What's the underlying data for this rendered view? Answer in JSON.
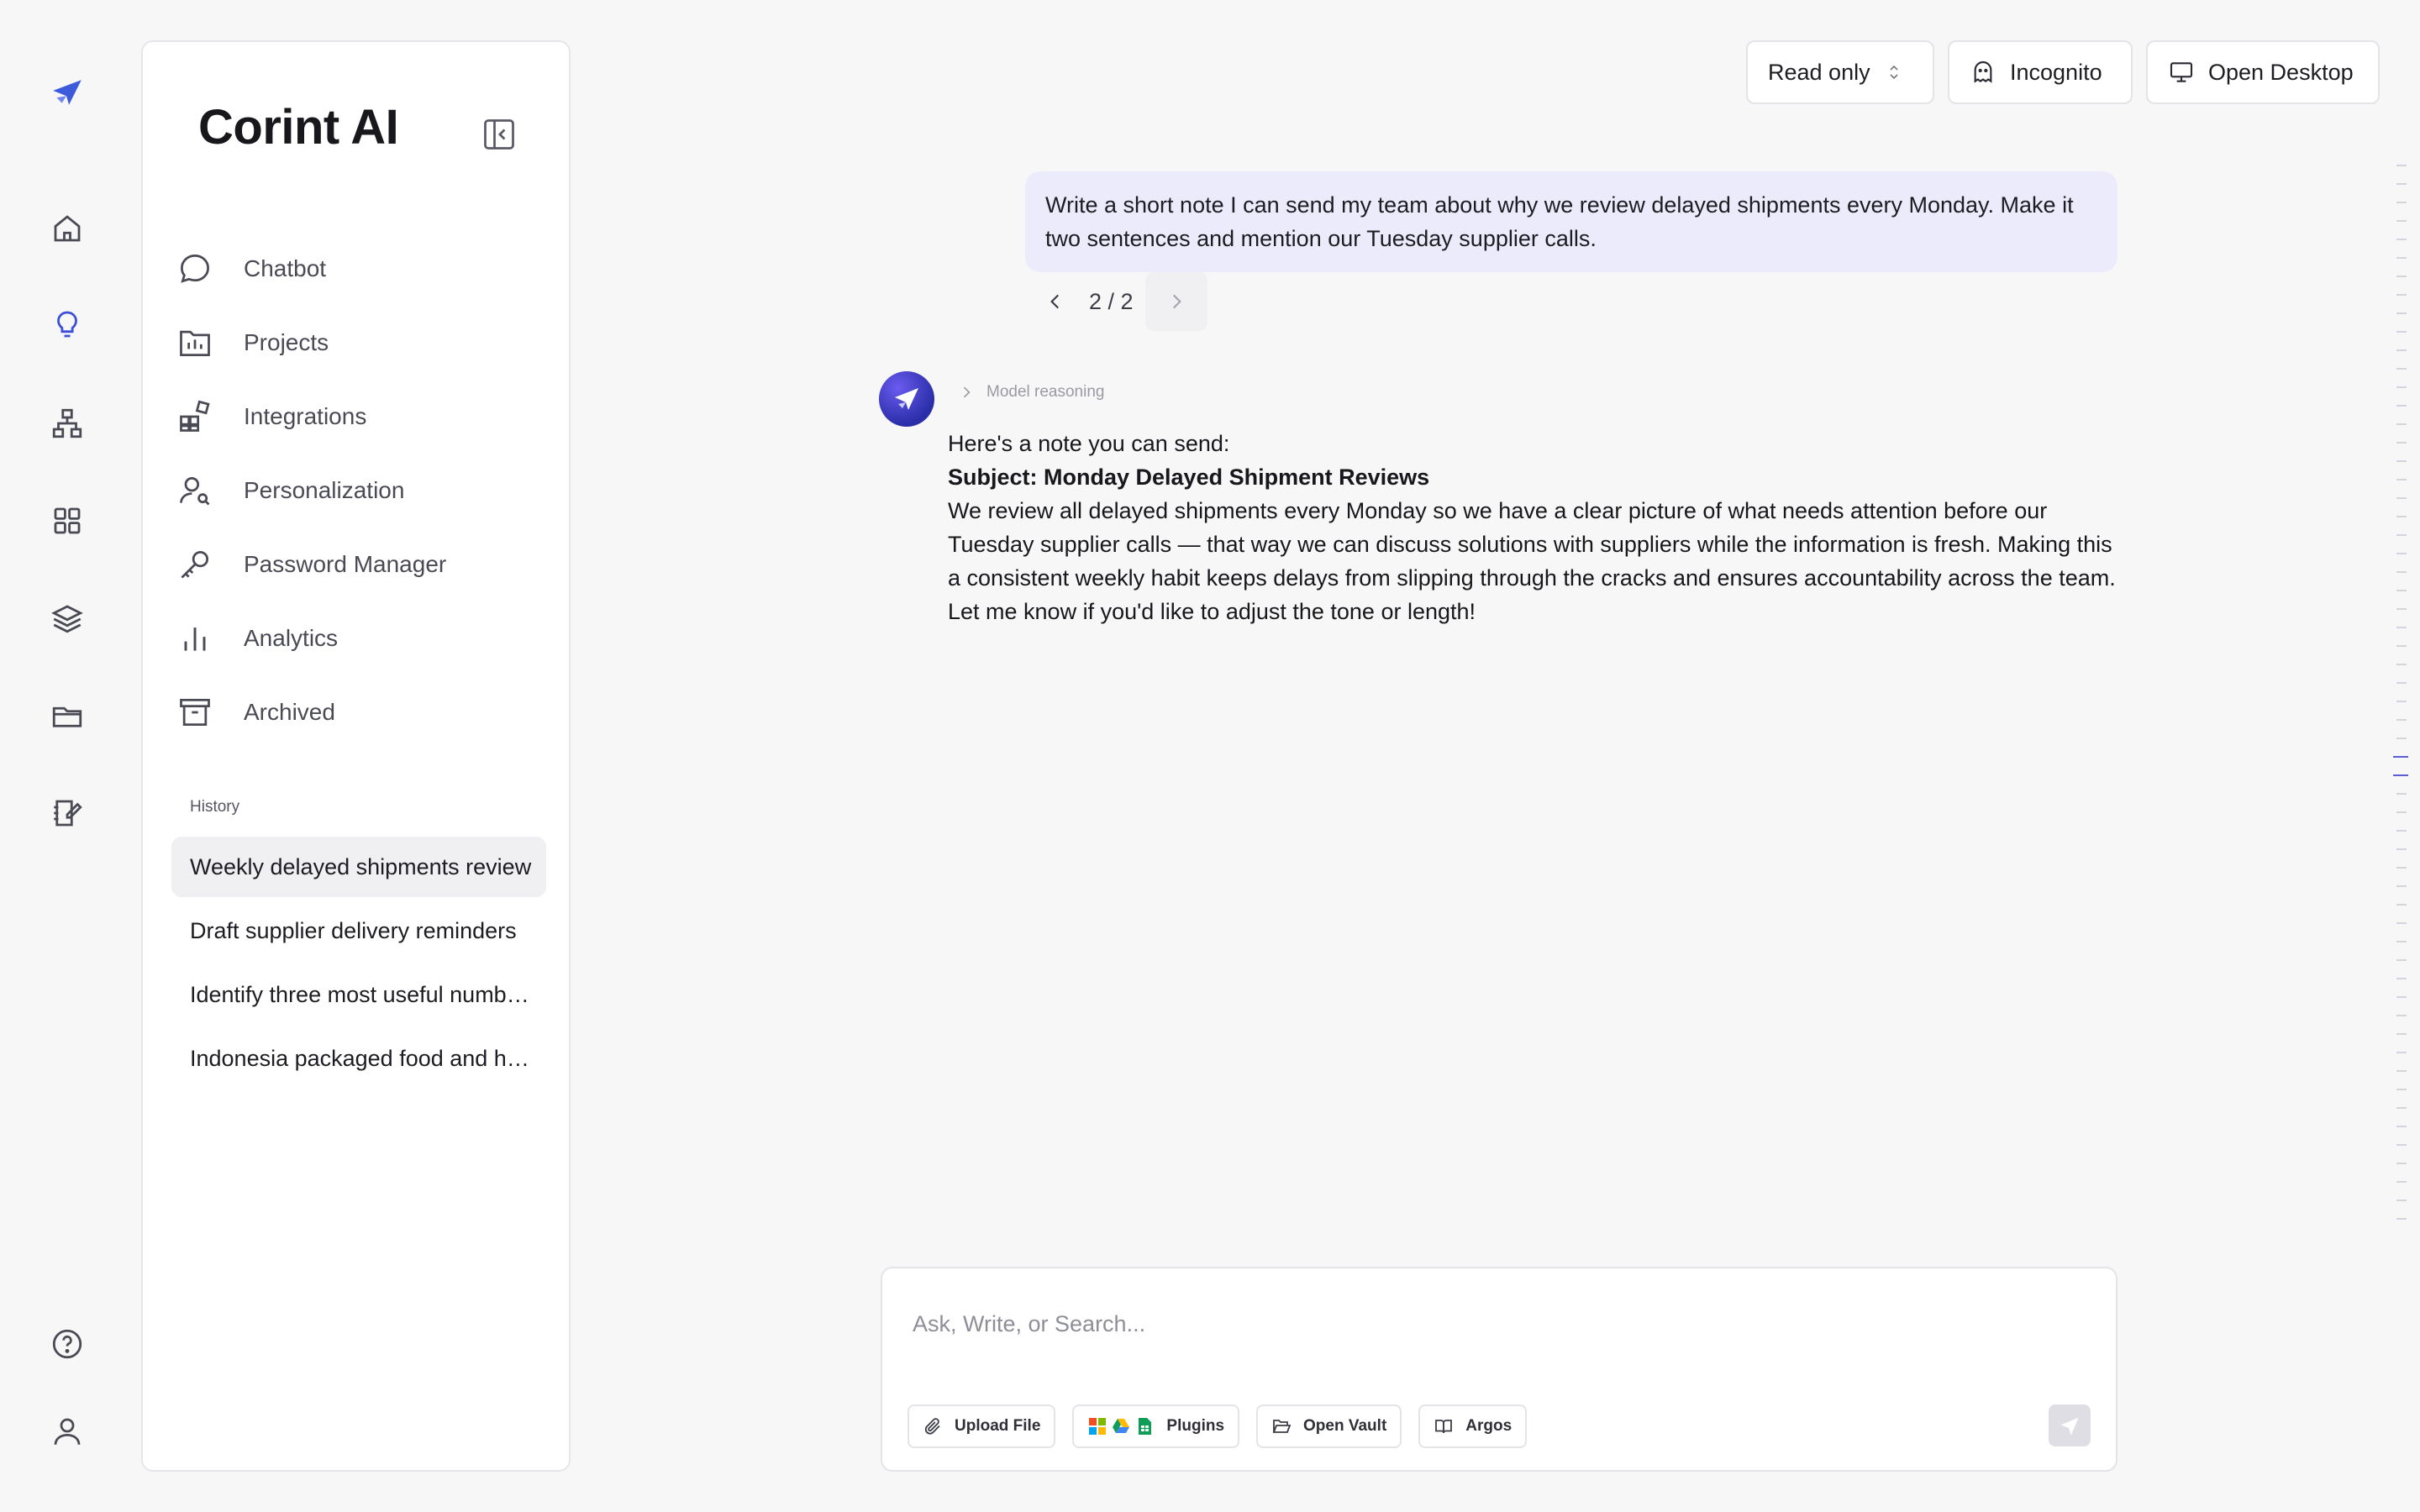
{
  "sidebar": {
    "brand": "Corint AI",
    "nav": [
      {
        "label": "Chatbot",
        "icon": "chat-bubble-icon"
      },
      {
        "label": "Projects",
        "icon": "project-folder-icon"
      },
      {
        "label": "Integrations",
        "icon": "integrations-icon"
      },
      {
        "label": "Personalization",
        "icon": "user-search-icon"
      },
      {
        "label": "Password Manager",
        "icon": "key-icon"
      },
      {
        "label": "Analytics",
        "icon": "bar-chart-icon"
      },
      {
        "label": "Archived",
        "icon": "archive-icon"
      }
    ],
    "history_title": "History",
    "history": [
      "Weekly delayed shipments review",
      "Draft supplier delivery reminders",
      "Identify three most useful numbers",
      "Indonesia packaged food and health"
    ]
  },
  "topbar": {
    "read_only": "Read only",
    "incognito": "Incognito",
    "open_desktop": "Open Desktop"
  },
  "conversation": {
    "user_message": "Write a short note I can send my team about why we review delayed shipments every Monday. Make it two sentences and mention our Tuesday supplier calls.",
    "pager": "2 / 2",
    "reasoning_label": "Model reasoning",
    "answer": {
      "intro": "Here's a note you can send:",
      "subject": "Subject: Monday Delayed Shipment Reviews",
      "body": "We review all delayed shipments every Monday so we have a clear picture of what needs attention before our Tuesday supplier calls — that way we can discuss solutions with suppliers while the information is fresh. Making this a consistent weekly habit keeps delays from slipping through the cracks and ensures accountability across the team.",
      "closing": "Let me know if you'd like to adjust the tone or length!"
    }
  },
  "composer": {
    "placeholder": "Ask, Write, or Search...",
    "tools": {
      "upload": "Upload File",
      "plugins": "Plugins",
      "vault": "Open Vault",
      "argos": "Argos"
    }
  },
  "colors": {
    "accent": "#3b4fd8",
    "user_bubble": "#ecebfb",
    "page_bg": "#f7f7f8"
  }
}
